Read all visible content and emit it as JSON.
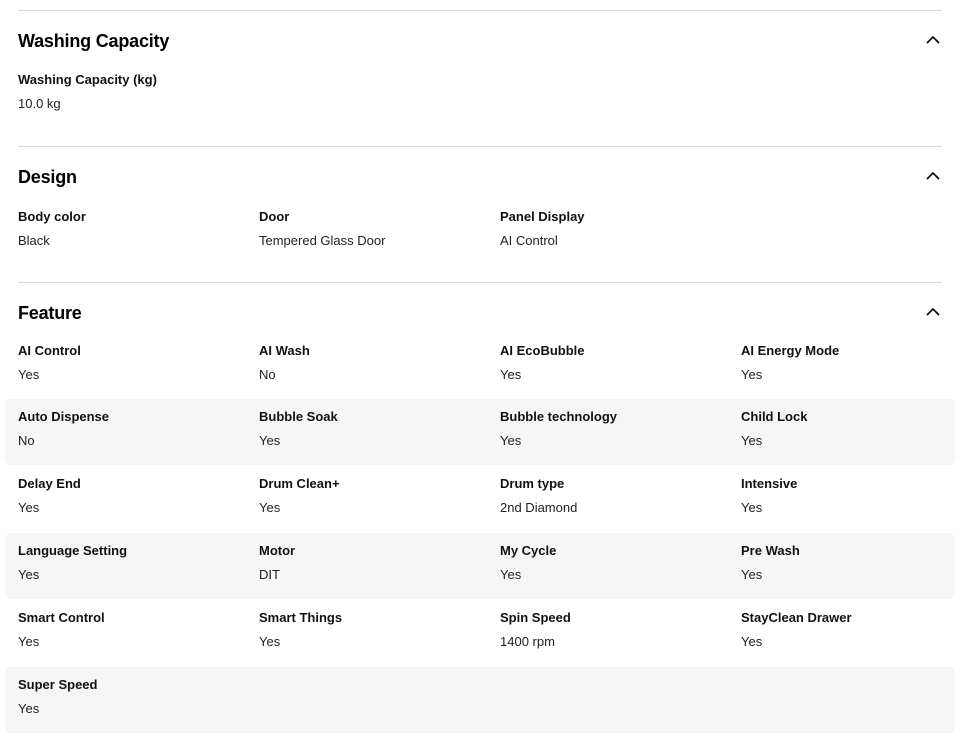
{
  "sections": [
    {
      "title": "Washing Capacity",
      "rows": [
        [
          {
            "label": "Washing Capacity (kg)",
            "value": "10.0 kg"
          }
        ]
      ]
    },
    {
      "title": "Design",
      "rows": [
        [
          {
            "label": "Body color",
            "value": "Black"
          },
          {
            "label": "Door",
            "value": "Tempered Glass Door"
          },
          {
            "label": "Panel Display",
            "value": "AI Control"
          }
        ]
      ]
    },
    {
      "title": "Feature",
      "rows": [
        [
          {
            "label": "AI Control",
            "value": "Yes"
          },
          {
            "label": "AI Wash",
            "value": "No"
          },
          {
            "label": "AI EcoBubble",
            "value": "Yes"
          },
          {
            "label": "AI Energy Mode",
            "value": "Yes"
          }
        ],
        [
          {
            "label": "Auto Dispense",
            "value": "No"
          },
          {
            "label": "Bubble Soak",
            "value": "Yes"
          },
          {
            "label": "Bubble technology",
            "value": "Yes"
          },
          {
            "label": "Child Lock",
            "value": "Yes"
          }
        ],
        [
          {
            "label": "Delay End",
            "value": "Yes"
          },
          {
            "label": "Drum Clean+",
            "value": "Yes"
          },
          {
            "label": "Drum type",
            "value": "2nd Diamond"
          },
          {
            "label": "Intensive",
            "value": "Yes"
          }
        ],
        [
          {
            "label": "Language Setting",
            "value": "Yes"
          },
          {
            "label": "Motor",
            "value": "DIT"
          },
          {
            "label": "My Cycle",
            "value": "Yes"
          },
          {
            "label": "Pre Wash",
            "value": "Yes"
          }
        ],
        [
          {
            "label": "Smart Control",
            "value": "Yes"
          },
          {
            "label": "Smart Things",
            "value": "Yes"
          },
          {
            "label": "Spin Speed",
            "value": "1400 rpm"
          },
          {
            "label": "StayClean Drawer",
            "value": "Yes"
          }
        ],
        [
          {
            "label": "Super Speed",
            "value": "Yes"
          }
        ]
      ]
    }
  ],
  "icons": {
    "collapse": "chevron-up-icon"
  },
  "colors": {
    "divider": "#dddddd",
    "shaded_row": "#f6f6f6"
  }
}
